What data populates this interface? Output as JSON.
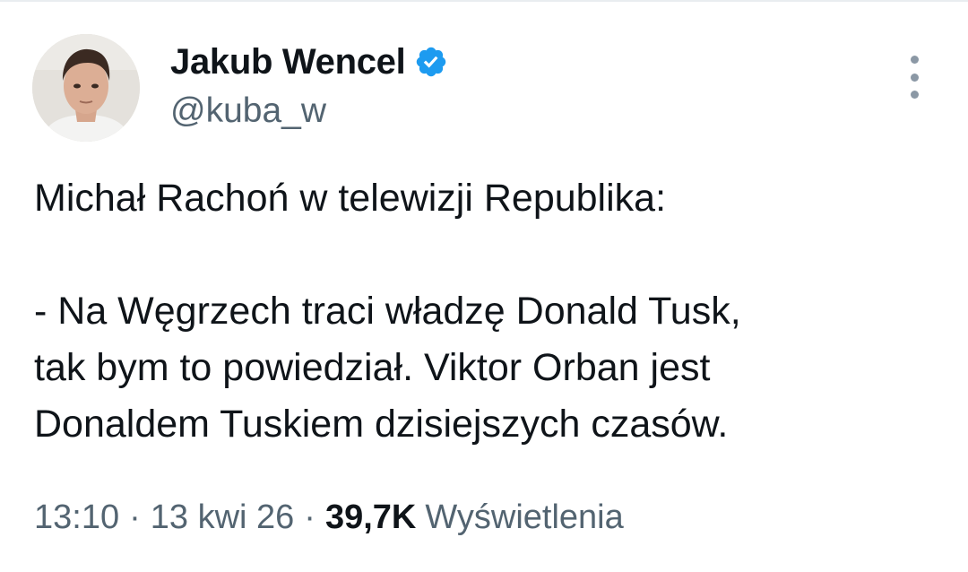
{
  "author": {
    "display_name": "Jakub Wencel",
    "handle": "@kuba_w",
    "verified": true,
    "verified_color": "#1d9bf0"
  },
  "icons": {
    "verified": "verified-badge-icon",
    "more": "more-vertical-icon"
  },
  "tweet": {
    "lines": [
      "Michał Rachoń w telewizji Republika:",
      "",
      "- Na Węgrzech traci władzę Donald Tusk,",
      "tak bym to powiedział. Viktor Orban jest",
      "Donaldem Tuskiem dzisiejszych czasów."
    ]
  },
  "meta": {
    "time": "13:10",
    "separator": "·",
    "date": "13 kwi 26",
    "views_count": "39,7K",
    "views_label": "Wyświetlenia"
  }
}
